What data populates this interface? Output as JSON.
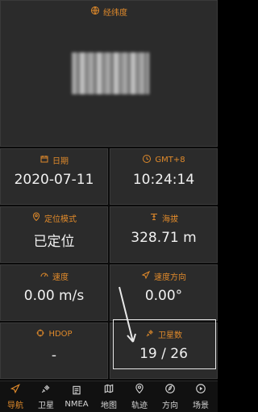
{
  "top": {
    "title": "经纬度"
  },
  "cards": {
    "date": {
      "title": "日期",
      "value": "2020-07-11"
    },
    "gmt": {
      "title": "GMT+8",
      "value": "10:24:14"
    },
    "mode": {
      "title": "定位模式",
      "value": "已定位"
    },
    "alt": {
      "title": "海拔",
      "value": "328.71 m"
    },
    "speed": {
      "title": "速度",
      "value": "0.00 m/s"
    },
    "dir": {
      "title": "速度方向",
      "value": "0.00°"
    },
    "hdop": {
      "title": "HDOP",
      "value": "-"
    },
    "sats": {
      "title": "卫星数",
      "value": "19 / 26"
    }
  },
  "tabs": [
    {
      "label": "导航",
      "icon": "navigation-icon"
    },
    {
      "label": "卫星",
      "icon": "satellite-icon"
    },
    {
      "label": "NMEA",
      "icon": "nmea-icon"
    },
    {
      "label": "地图",
      "icon": "map-icon"
    },
    {
      "label": "轨迹",
      "icon": "track-icon"
    },
    {
      "label": "方向",
      "icon": "compass-icon"
    },
    {
      "label": "场景",
      "icon": "scene-icon"
    }
  ],
  "colors": {
    "accent": "#e08a2b",
    "card": "#2b2b2b",
    "text": "#f1f1f1"
  }
}
